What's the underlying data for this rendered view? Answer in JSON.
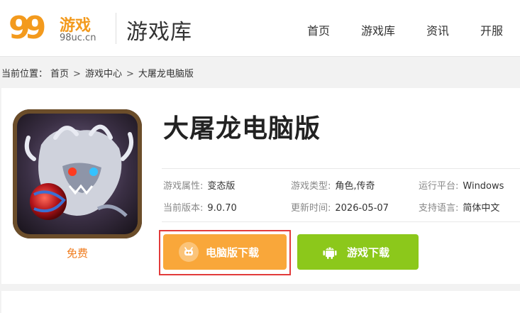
{
  "logo": {
    "mark": "99",
    "name": "游戏",
    "domain": "98uc.cn"
  },
  "header": {
    "section_title": "游戏库",
    "nav": [
      {
        "label": "首页"
      },
      {
        "label": "游戏库"
      },
      {
        "label": "资讯"
      },
      {
        "label": "开服"
      }
    ]
  },
  "breadcrumb": {
    "prefix": "当前位置：",
    "items": [
      "首页",
      "游戏中心",
      "大屠龙电脑版"
    ],
    "separator": ">"
  },
  "game": {
    "title": "大屠龙电脑版",
    "price_label": "免费",
    "info": [
      {
        "key": "游戏属性:",
        "value": "变态版"
      },
      {
        "key": "游戏类型:",
        "value": "角色,传奇"
      },
      {
        "key": "运行平台:",
        "value": "Windows"
      },
      {
        "key": "当前版本:",
        "value": "9.0.70"
      },
      {
        "key": "更新时间:",
        "value": "2026-05-07"
      },
      {
        "key": "支持语言:",
        "value": "简体中文"
      }
    ]
  },
  "buttons": {
    "pc_download": "电脑版下载",
    "game_download": "游戏下载"
  },
  "colors": {
    "accent_orange": "#f9a73a",
    "accent_green": "#8cc81b",
    "highlight_red": "#e23b3b"
  }
}
